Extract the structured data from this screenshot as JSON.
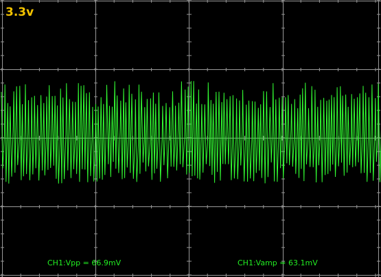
{
  "screen": {
    "voltage_label": "3.3v",
    "label_color": "#f2c200",
    "trace_color": "#33ff33",
    "measure_color": "#22ee22",
    "grid_color": "#9a9a9a",
    "background_color": "#000000"
  },
  "measurements": [
    {
      "name": "CH1:Vpp",
      "value": "66.9mV"
    },
    {
      "name": "CH1:Vamp",
      "value": "63.1mV"
    }
  ],
  "icons": {
    "trace": "waveform-trace-icon",
    "graticule": "graticule-grid-icon"
  }
}
